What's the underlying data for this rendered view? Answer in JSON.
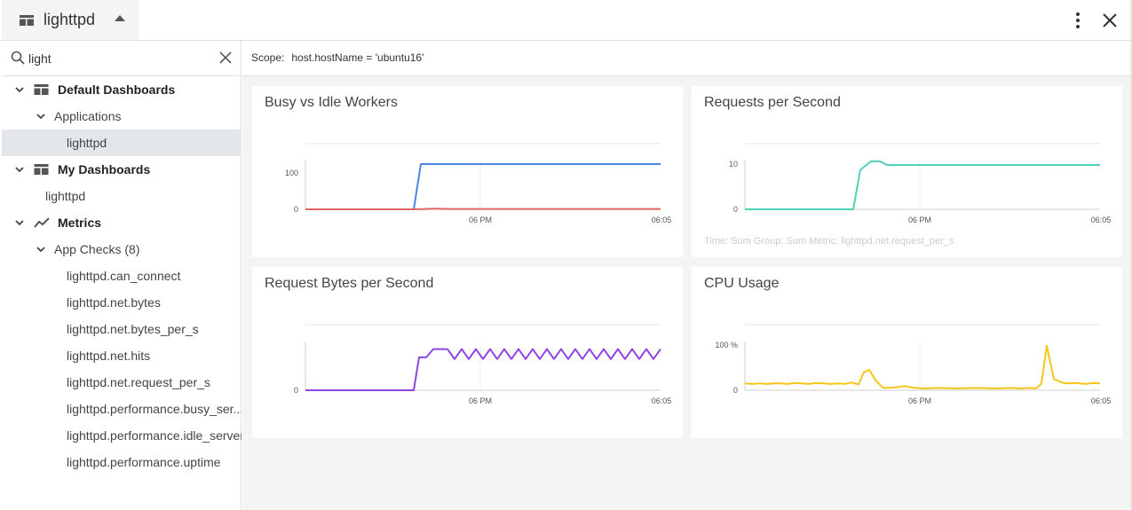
{
  "header": {
    "title": "lighttpd",
    "icons": [
      "dashboard-icon",
      "caret-up-icon",
      "more-vert-icon",
      "close-icon"
    ]
  },
  "search": {
    "value": "light",
    "icons": [
      "search-icon",
      "clear-icon"
    ]
  },
  "tree": {
    "default_dashboards": "Default Dashboards",
    "applications": "Applications",
    "applications_child": "lighttpd",
    "my_dashboards": "My Dashboards",
    "my_dashboards_child": "lighttpd",
    "metrics": "Metrics",
    "app_checks": "App Checks (8)",
    "metric_items": [
      "lighttpd.can_connect",
      "lighttpd.net.bytes",
      "lighttpd.net.bytes_per_s",
      "lighttpd.net.hits",
      "lighttpd.net.request_per_s",
      "lighttpd.performance.busy_ser...",
      "lighttpd.performance.idle_server",
      "lighttpd.performance.uptime"
    ]
  },
  "scope": {
    "label": "Scope:",
    "value": "host.hostName = 'ubuntu16'"
  },
  "panels": {
    "busy": {
      "title": "Busy vs Idle Workers"
    },
    "rps": {
      "title": "Requests per Second",
      "footer": "Time: Sum   Group: Sum   Metric: lighttpd.net.request_per_s"
    },
    "bytes": {
      "title": "Request Bytes per Second"
    },
    "cpu": {
      "title": "CPU Usage"
    }
  },
  "colors": {
    "busy": "#4a86e8",
    "idle": "#e06666",
    "rps": "#4dd0b8",
    "bytes": "#8e44e0",
    "cpu": "#f5c518"
  },
  "chart_data": [
    {
      "type": "line",
      "title": "Busy vs Idle Workers",
      "x_ticks": [
        "06 PM",
        "06:05"
      ],
      "y_ticks": [
        "0",
        "100"
      ],
      "ylim": [
        0,
        125
      ],
      "series": [
        {
          "color": "#4a86e8",
          "x": [
            0,
            0.305,
            0.325,
            1
          ],
          "values": [
            0,
            0,
            125,
            125
          ]
        },
        {
          "color": "#e06666",
          "x": [
            0,
            0.305,
            0.37,
            0.4,
            1
          ],
          "values": [
            0,
            0,
            2,
            1,
            1
          ]
        }
      ]
    },
    {
      "type": "line",
      "title": "Requests per Second",
      "x_ticks": [
        "06 PM",
        "06:05"
      ],
      "y_ticks": [
        "0",
        "10"
      ],
      "ylim": [
        0,
        10
      ],
      "series": [
        {
          "color": "#4dd0b8",
          "x": [
            0,
            0.305,
            0.325,
            0.355,
            0.38,
            0.4,
            1
          ],
          "values": [
            0,
            0,
            8.7,
            10.6,
            10.6,
            9.8,
            9.8
          ]
        }
      ]
    },
    {
      "type": "line",
      "title": "Request Bytes per Second",
      "x_ticks": [
        "06 PM",
        "06:05"
      ],
      "y_ticks": [
        "0"
      ],
      "ylim": [
        0,
        55
      ],
      "series": [
        {
          "color": "#8e44e0",
          "x": [
            0,
            0.305,
            0.32,
            0.34,
            0.36,
            0.4,
            0.42,
            0.44,
            0.46,
            0.48,
            0.5,
            0.52,
            0.54,
            0.56,
            0.58,
            0.6,
            0.62,
            0.64,
            0.66,
            0.68,
            0.7,
            0.72,
            0.74,
            0.76,
            0.78,
            0.8,
            0.82,
            0.84,
            0.86,
            0.88,
            0.9,
            0.92,
            0.94,
            0.96,
            0.98,
            1.0
          ],
          "values": [
            0,
            0,
            40,
            40,
            50,
            50,
            38,
            50,
            38,
            50,
            38,
            50,
            38,
            50,
            38,
            50,
            38,
            50,
            38,
            50,
            38,
            50,
            38,
            50,
            38,
            50,
            38,
            50,
            38,
            50,
            38,
            50,
            38,
            50,
            38,
            50
          ]
        }
      ]
    },
    {
      "type": "line",
      "title": "CPU Usage",
      "x_ticks": [
        "06 PM",
        "06:05"
      ],
      "y_ticks": [
        "0",
        "100 %"
      ],
      "ylim": [
        0,
        100
      ],
      "series": [
        {
          "color": "#f5c518",
          "x": [
            0,
            0.02,
            0.04,
            0.06,
            0.08,
            0.1,
            0.12,
            0.14,
            0.16,
            0.18,
            0.2,
            0.22,
            0.24,
            0.26,
            0.28,
            0.3,
            0.32,
            0.335,
            0.35,
            0.37,
            0.39,
            0.42,
            0.45,
            0.47,
            0.5,
            0.55,
            0.6,
            0.65,
            0.7,
            0.75,
            0.78,
            0.8,
            0.82,
            0.835,
            0.85,
            0.87,
            0.9,
            0.93,
            0.96,
            0.98,
            1.0
          ],
          "values": [
            15,
            14,
            15,
            14,
            15,
            15,
            14,
            16,
            15,
            14,
            16,
            15,
            14,
            15,
            14,
            17,
            13,
            40,
            45,
            20,
            5,
            6,
            9,
            6,
            4,
            5,
            4,
            5,
            4,
            5,
            4,
            5,
            4,
            15,
            98,
            25,
            15,
            16,
            14,
            16,
            15
          ]
        }
      ]
    }
  ]
}
